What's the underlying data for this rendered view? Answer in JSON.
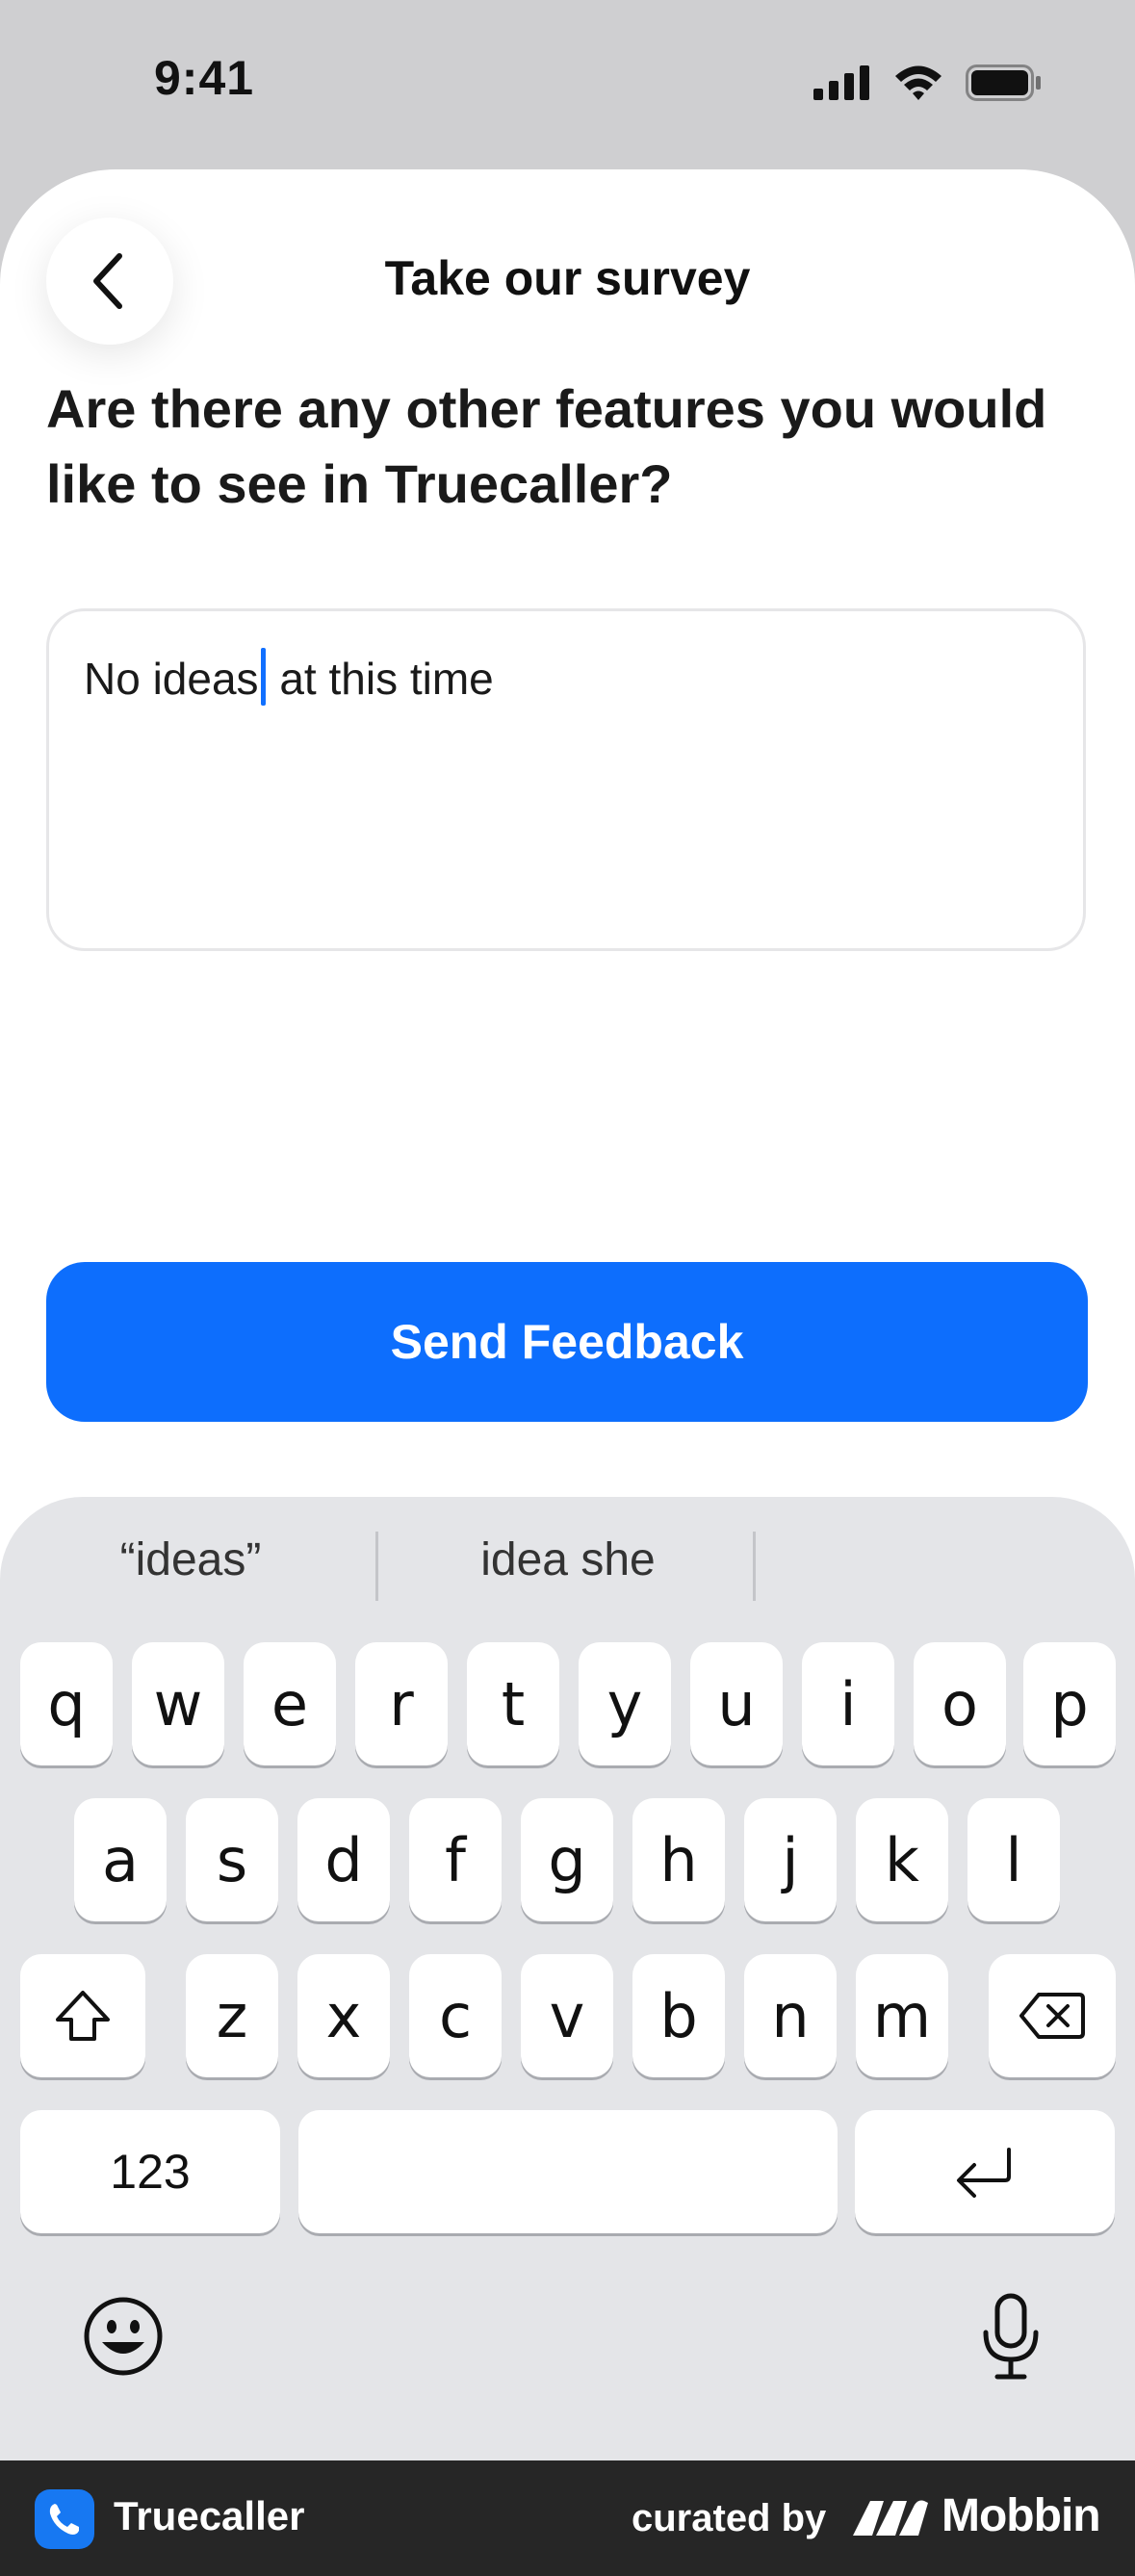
{
  "status_bar": {
    "time": "9:41"
  },
  "header": {
    "title": "Take our survey"
  },
  "question": {
    "text": "Are there any other features you would like to see in Truecaller?"
  },
  "feedback": {
    "text_before_caret": "No ideas",
    "text_after_caret": " at this time"
  },
  "send_button": {
    "label": "Send Feedback"
  },
  "keyboard": {
    "suggestions": [
      "“ideas”",
      "idea she",
      ""
    ],
    "row1": [
      "q",
      "w",
      "e",
      "r",
      "t",
      "y",
      "u",
      "i",
      "o",
      "p"
    ],
    "row2": [
      "a",
      "s",
      "d",
      "f",
      "g",
      "h",
      "j",
      "k",
      "l"
    ],
    "row3": [
      "z",
      "x",
      "c",
      "v",
      "b",
      "n",
      "m"
    ],
    "numbers_key": "123",
    "icons": {
      "shift": "shift-icon",
      "delete": "delete-icon",
      "return": "return-icon",
      "emoji": "emoji-icon",
      "mic": "microphone-icon"
    }
  },
  "footer": {
    "app_name": "Truecaller",
    "curated_by": "curated by",
    "brand": "Mobbin"
  },
  "colors": {
    "accent": "#0d6efd",
    "caret": "#1170ff",
    "keyboard_bg": "#e4e5e8",
    "footer_bg": "#262626"
  }
}
